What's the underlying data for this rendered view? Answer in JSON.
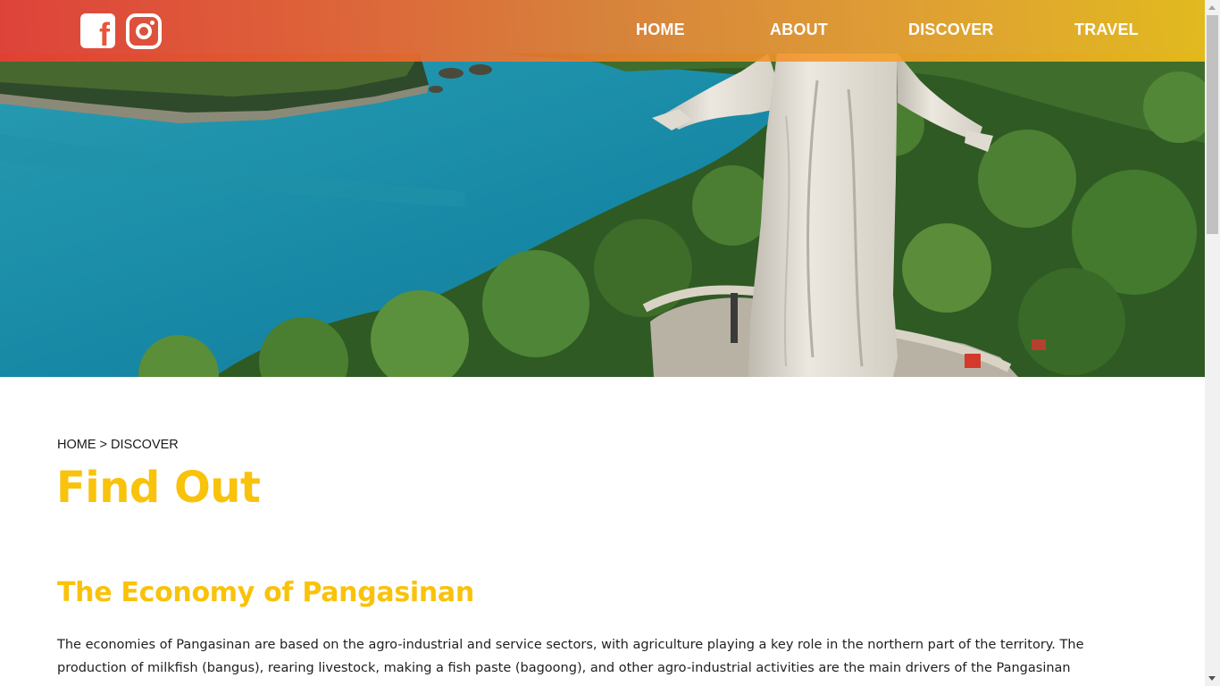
{
  "social": {
    "facebook_icon": "facebook-icon",
    "instagram_icon": "instagram-icon",
    "facebook_glyph": "f"
  },
  "nav": {
    "items": [
      {
        "label": "HOME"
      },
      {
        "label": "ABOUT"
      },
      {
        "label": "DISCOVER"
      },
      {
        "label": "TRAVEL"
      }
    ]
  },
  "hero": {
    "image": "aerial-photo-statue-islands"
  },
  "breadcrumb": {
    "home": "HOME",
    "separator": " > ",
    "current": "DISCOVER"
  },
  "page_title": "Find Out",
  "section": {
    "title": "The Economy of Pangasinan",
    "paragraph": "The economies of Pangasinan are based on the agro-industrial and service sectors, with agriculture playing a key role in the northern part of the territory. The production of milkfish (bangus), rearing livestock, making a fish paste (bagoong), and other agro-industrial activities are the main drivers of the Pangasinan"
  },
  "colors": {
    "accent": "#f9c20b",
    "header_start": "#e83e34",
    "header_end": "#ecbc18",
    "text": "#1f1f1f"
  }
}
